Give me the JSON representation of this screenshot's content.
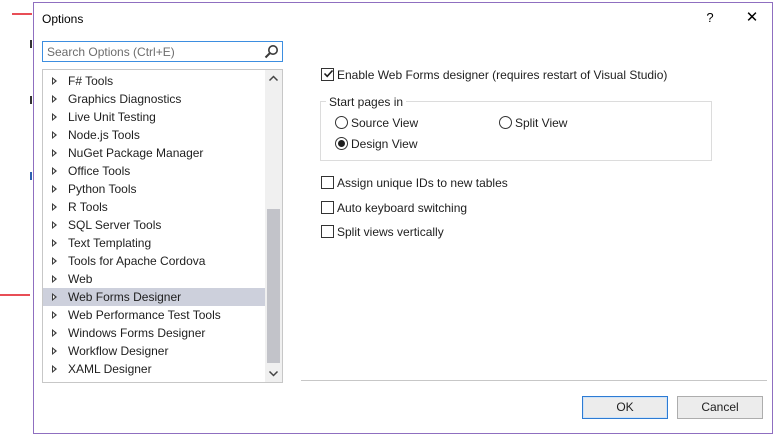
{
  "window": {
    "title": "Options",
    "help_label": "?",
    "close_label": "✕"
  },
  "search": {
    "placeholder": "Search Options (Ctrl+E)",
    "value": ""
  },
  "tree": {
    "items": [
      {
        "label": "F# Tools",
        "selected": false
      },
      {
        "label": "Graphics Diagnostics",
        "selected": false
      },
      {
        "label": "Live Unit Testing",
        "selected": false
      },
      {
        "label": "Node.js Tools",
        "selected": false
      },
      {
        "label": "NuGet Package Manager",
        "selected": false
      },
      {
        "label": "Office Tools",
        "selected": false
      },
      {
        "label": "Python Tools",
        "selected": false
      },
      {
        "label": "R Tools",
        "selected": false
      },
      {
        "label": "SQL Server Tools",
        "selected": false
      },
      {
        "label": "Text Templating",
        "selected": false
      },
      {
        "label": "Tools for Apache Cordova",
        "selected": false
      },
      {
        "label": "Web",
        "selected": false
      },
      {
        "label": "Web Forms Designer",
        "selected": true
      },
      {
        "label": "Web Performance Test Tools",
        "selected": false
      },
      {
        "label": "Windows Forms Designer",
        "selected": false
      },
      {
        "label": "Workflow Designer",
        "selected": false
      },
      {
        "label": "XAML Designer",
        "selected": false
      }
    ]
  },
  "settings": {
    "enable_designer": {
      "label": "Enable Web Forms designer (requires restart of Visual Studio)",
      "checked": true
    },
    "start_pages": {
      "legend": "Start pages in",
      "source_view": {
        "label": "Source View",
        "selected": false
      },
      "split_view": {
        "label": "Split View",
        "selected": false
      },
      "design_view": {
        "label": "Design View",
        "selected": true
      }
    },
    "assign_ids": {
      "label": "Assign unique IDs to new tables",
      "checked": false
    },
    "auto_keyboard": {
      "label": "Auto keyboard switching",
      "checked": false
    },
    "split_vertically": {
      "label": "Split views vertically",
      "checked": false
    }
  },
  "buttons": {
    "ok": "OK",
    "cancel": "Cancel"
  },
  "colors": {
    "accent": "#3d8ee0",
    "selection": "#cdd0dc",
    "annotation": "#e0141e",
    "window_border": "#8f6fc0"
  }
}
